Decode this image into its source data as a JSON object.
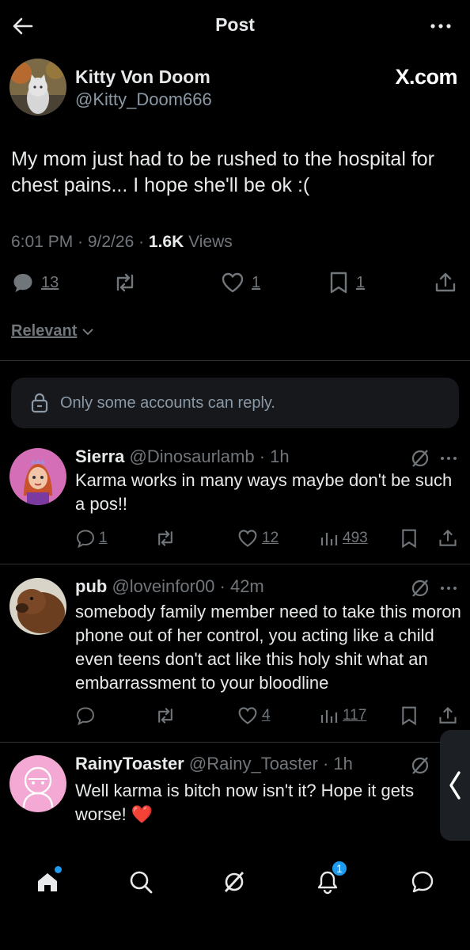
{
  "header": {
    "title": "Post"
  },
  "post": {
    "author_name": "Kitty Von Doom",
    "author_handle": "@Kitty_Doom666",
    "brand": "X.com",
    "text": "My mom just had to be rushed to the hospital for chest pains... I hope she'll be ok :(",
    "time": "6:01 PM · 9/2/26 · ",
    "views_count": "1.6K",
    "views_label": " Views",
    "replies": "13",
    "likes": "1",
    "bookmarks": "1"
  },
  "sort": {
    "label": "Relevant"
  },
  "reply_restriction": "Only some accounts can reply.",
  "replies": [
    {
      "name": "Sierra",
      "handle": "@Dinosaurlamb · 1h",
      "text": "Karma works in many ways maybe don't be such a pos!!",
      "replies": "1",
      "likes": "12",
      "views": "493",
      "avatar_color": "#d46fb7"
    },
    {
      "name": "pub",
      "handle": "@loveinfor00 · 42m",
      "text": "somebody family member need to take this moron phone out of her control,  you acting like a child even teens don't act like this holy shit what an embarrassment to your bloodline",
      "replies": "",
      "likes": "4",
      "views": "117",
      "avatar_color": "#6b4a2b"
    },
    {
      "name": "RainyToaster",
      "handle": "@Rainy_Toaster · 1h",
      "text": "Well karma is bitch now isn't it? Hope it gets worse! ❤️",
      "avatar_color": "#f3a9d4"
    }
  ],
  "nav": {
    "notifications_badge": "1"
  },
  "colors": {
    "accent": "#1d9bf0",
    "muted": "#71767b",
    "background": "#000000",
    "heart": "#e0245e"
  }
}
